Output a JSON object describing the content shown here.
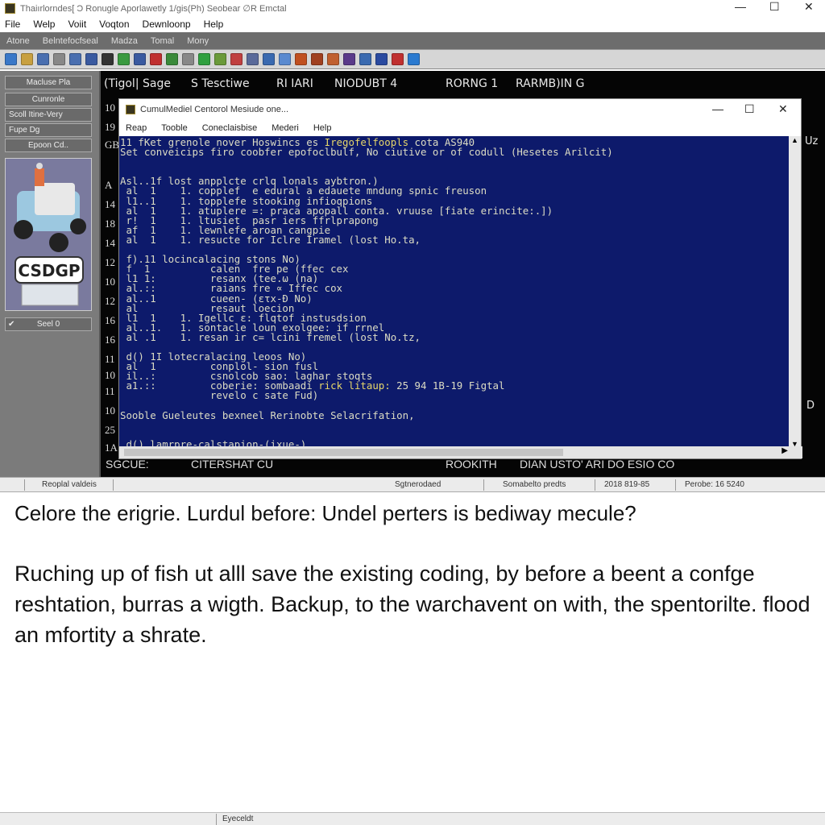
{
  "window": {
    "title": "Thaiırlorndes[ Ɔ Ronugle Aporlawetly 1/gis(Ph) Seobear ∅R Emctal",
    "minimize": "—",
    "maximize": "☐",
    "close": "✕"
  },
  "menu": [
    "File",
    "Welp",
    "Voiit",
    "Voqton",
    "Dewnloonp",
    "Help"
  ],
  "toolbar1": [
    "Atone",
    "Belntefocfseal",
    "Madza",
    "Tomal",
    "Mony"
  ],
  "toolbar2_icons": [
    "#3a78c8",
    "#c8a040",
    "#4a6fb0",
    "#888888",
    "#4a6fb0",
    "#3a5aa0",
    "#333333",
    "#3a9a40",
    "#3a5aa0",
    "#c03030",
    "#3a8a3a",
    "#888888",
    "#30a040",
    "#6a9a3a",
    "#c04040",
    "#5a6a9a",
    "#3a6ab0",
    "#5a8ad0",
    "#c05020",
    "#a04020",
    "#c06030",
    "#5a3a8a",
    "#3a6ab0",
    "#2a4aa0",
    "#c03030",
    "#2a7ad0"
  ],
  "sidebar": {
    "buttons": [
      "Macluse Pla",
      "Cunronle",
      "Scoll Itine-Very",
      "Fupe Dg",
      "Epoon Cd.."
    ],
    "logo": "CSDGP",
    "bottom": "Seel 0"
  },
  "main": {
    "headers": [
      "(Tigol| Sage",
      "S Tesctiwe",
      "RI IARI",
      "NIODUBT 4",
      "RORNG 1",
      "RARMB)IN G"
    ],
    "gutter": [
      "10",
      "19",
      "GB",
      "A",
      "14",
      "18",
      "14",
      "12",
      "10",
      "12",
      "16",
      "16",
      "11",
      "10",
      "11",
      "10",
      "25",
      "1A"
    ],
    "right_labels": [
      "Uz",
      "D"
    ],
    "bottom_labels": [
      "SGCUE:",
      "CITERSHAT  CU",
      "ROOKITH",
      "DIAN USTO' ARI DO ESIO CO"
    ]
  },
  "dialog": {
    "title": "CumulMediel Centorol Mesiude one...",
    "minimize": "—",
    "maximize": "☐",
    "close": "✕",
    "menu": [
      "Reap",
      "Tooble",
      "Coneclaisbise",
      "Mederi",
      "Help"
    ],
    "terminal_lines": [
      [
        {
          "t": "11 fKet grenole nover Hoswincs es "
        },
        {
          "t": "Iregofelfoopls",
          "hl": true
        },
        {
          "t": " cota AS940"
        }
      ],
      [
        {
          "t": "Set conveicips firo coobfer epofoclbulf, No ciutive or of codull (Hesetes Arilcit)"
        }
      ],
      [],
      [],
      [
        {
          "t": "Asl..1f lost anpplcte crlq lonals aybtron.)"
        }
      ],
      [
        {
          "t": " al  1    1. copplef  e edural a edauete mndung spnic freuson"
        }
      ],
      [
        {
          "t": " l1..1    1. topplefe stooking infioqpions"
        }
      ],
      [
        {
          "t": " al  1    1. atuplere =: praca apopall conta. vruuse [fiate erincite:.])"
        }
      ],
      [
        {
          "t": " r!  1    1. ltusiet  pasr iers ffrlprapong"
        }
      ],
      [
        {
          "t": " af  1    1. lewnlefe aroan cangpie"
        }
      ],
      [
        {
          "t": " al  1    1. resucte for Iclre Iramel (lost Ho.ta,"
        }
      ],
      [],
      [
        {
          "t": " f).11 locincalacing stons No)"
        }
      ],
      [
        {
          "t": " f  1          calen  fre pe (ffec cex"
        }
      ],
      [
        {
          "t": " l1 1:         resanx (tee.ω (na)"
        }
      ],
      [
        {
          "t": " al.::         raians fre ∝ Iffec cox"
        }
      ],
      [
        {
          "t": " al..1         cueen- (ετx-Ð No)"
        }
      ],
      [
        {
          "t": " al            resaut loecion"
        }
      ],
      [
        {
          "t": " l1  1    1. Igellc ε: flqtof instusdsion"
        }
      ],
      [
        {
          "t": " al..1.   1. sontacle loun exolgee: if rrnel"
        }
      ],
      [
        {
          "t": " al .1    1. resan ir c= lcini fremel (lost No.tz,"
        }
      ],
      [],
      [
        {
          "t": " d() 1I lotecralacing leoos No)"
        }
      ],
      [
        {
          "t": " al  1         conplol- sion fusl"
        }
      ],
      [
        {
          "t": " il..:         csnolcob sao: laghar stoqts"
        }
      ],
      [
        {
          "t": " a1.::         coberie: sombaadi "
        },
        {
          "t": "rick litaup:",
          "hl": true
        },
        {
          "t": " 25 94 1B-19 Figtal"
        }
      ],
      [
        {
          "t": "               revelo c sate Fud)"
        }
      ],
      [],
      [
        {
          "t": "Sooble Gueleutes bexneel Rerinobte Selacrifation,"
        }
      ],
      [],
      [],
      [
        {
          "t": " d() lamrpre-calstapion-(ixue-)_"
        }
      ]
    ]
  },
  "statusbar": [
    "Reoplal valdeis",
    "Sgtnerodaed",
    "Somabelto predts",
    "2018 819-85",
    "Perobe: 16 5240"
  ],
  "body": {
    "heading": "Celore the erigrie. Lurdul before: Undel perters is bediway mecule?",
    "paragraph": "Ruching up of fish ut alll save the existing coding, by before a beent a confge reshtation, burras a wigth. Backup, to the warchavent on with, the spentorilte. flood an mfortity a shrate."
  },
  "bottombar": {
    "label": "Eyeceldt"
  }
}
